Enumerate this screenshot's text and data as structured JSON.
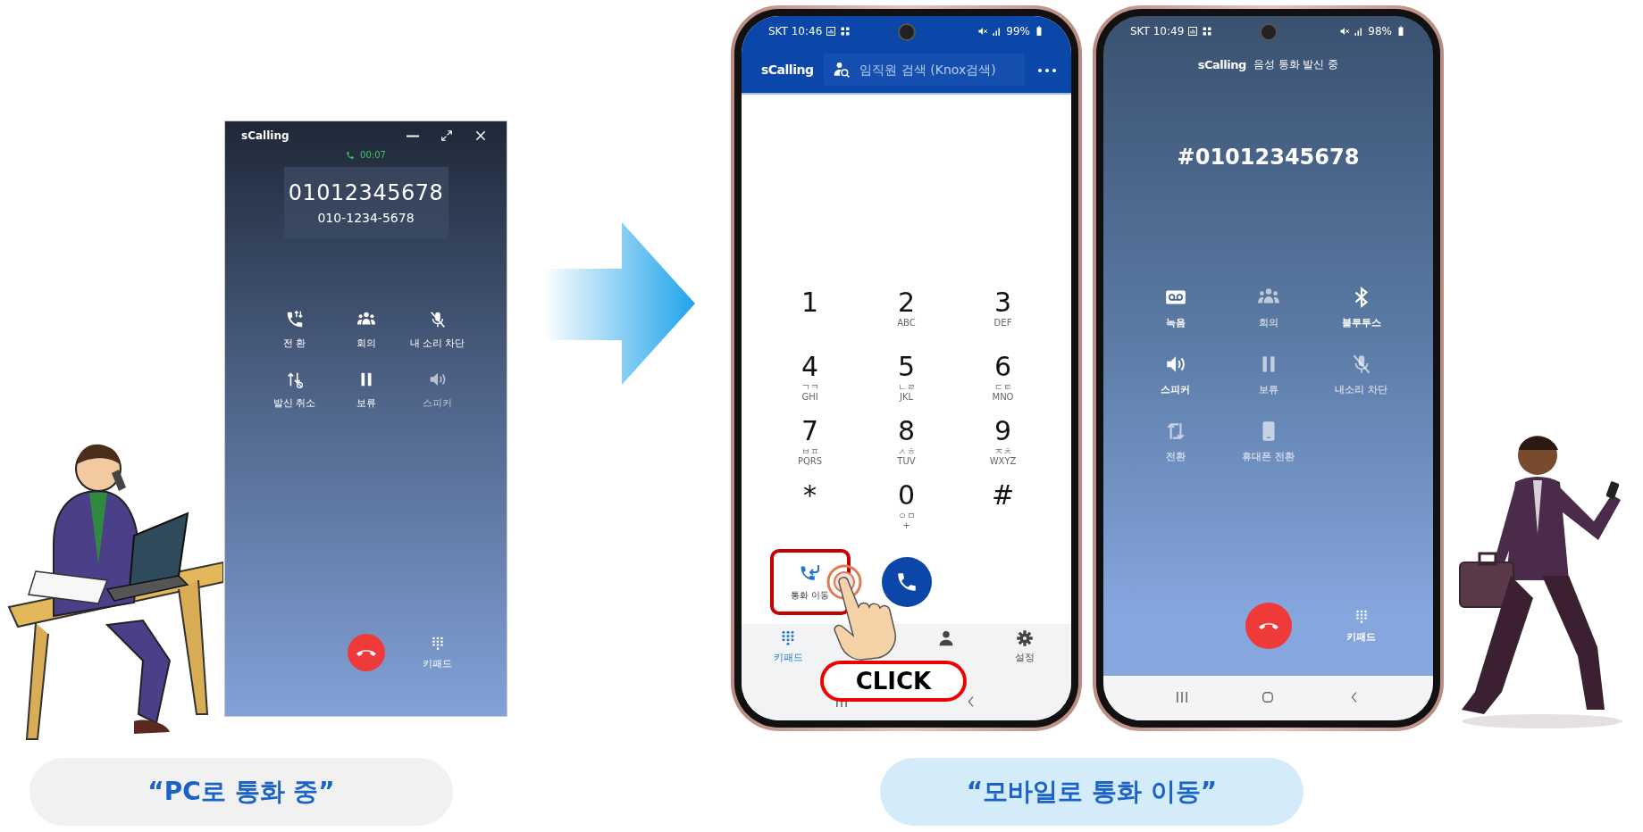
{
  "pc_window": {
    "title": "sCalling",
    "timer": "00:07",
    "number": "01012345678",
    "formatted_number": "010-1234-5678",
    "buttons": [
      {
        "kind": "phone_switch",
        "label": "전 환",
        "disabled": false
      },
      {
        "kind": "group",
        "label": "회의",
        "disabled": false
      },
      {
        "kind": "mic_off",
        "label": "내 소리 차단",
        "disabled": false
      },
      {
        "kind": "transfer_cancel",
        "label": "발신 취소",
        "disabled": false
      },
      {
        "kind": "pause",
        "label": "보류",
        "disabled": false
      },
      {
        "kind": "speaker",
        "label": "스피커",
        "disabled": true
      }
    ],
    "keypad_label": "키패드"
  },
  "dialer_phone": {
    "status_bar": {
      "carrier_time": "SKT 10:46",
      "battery": "99%"
    },
    "app_name": "sCalling",
    "search": {
      "placeholder": "임직원 검색 (Knox검색)"
    },
    "keys": [
      {
        "digit": "1"
      },
      {
        "digit": "2",
        "letters": [
          "ABC"
        ]
      },
      {
        "digit": "3",
        "letters": [
          "DEF"
        ]
      },
      {
        "digit": "4",
        "letters": [
          "ㄱㅋ",
          "GHI"
        ]
      },
      {
        "digit": "5",
        "letters": [
          "ㄴㄹ",
          "JKL"
        ]
      },
      {
        "digit": "6",
        "letters": [
          "ㄷㅌ",
          "MNO"
        ]
      },
      {
        "digit": "7",
        "letters": [
          "ㅂㅍ",
          "PQRS"
        ]
      },
      {
        "digit": "8",
        "letters": [
          "ㅅㅎ",
          "TUV"
        ]
      },
      {
        "digit": "9",
        "letters": [
          "ㅈㅊ",
          "WXYZ"
        ]
      },
      {
        "digit": "*"
      },
      {
        "digit": "0",
        "letters": [
          "ㅇㅁ",
          "+"
        ]
      },
      {
        "digit": "#"
      }
    ],
    "call_move_button": {
      "label": "통화 이동",
      "highlighted": true
    },
    "tabs": [
      {
        "kind": "keypad",
        "label": "키패드",
        "selected": true
      },
      {
        "kind": "person",
        "selected": false
      },
      {
        "kind": "gear",
        "label": "설정",
        "selected": false
      }
    ],
    "click_badge": "CLICK"
  },
  "call_phone": {
    "status_bar": {
      "carrier_time": "SKT 10:49",
      "battery": "98%"
    },
    "app_name": "sCalling",
    "call_status": "음성 통화 발신 중",
    "number": "#01012345678",
    "buttons": [
      {
        "kind": "voicemail",
        "label": "녹음",
        "disabled": false
      },
      {
        "kind": "group",
        "label": "회의",
        "disabled": true
      },
      {
        "kind": "bluetooth",
        "label": "블루투스",
        "disabled": false
      },
      {
        "kind": "speaker",
        "label": "스피커",
        "disabled": false
      },
      {
        "kind": "pause",
        "label": "보류",
        "disabled": true
      },
      {
        "kind": "mic_off",
        "label": "내소리 차단",
        "disabled": true
      },
      {
        "kind": "transfer",
        "label": "전환",
        "disabled": true
      },
      {
        "kind": "device",
        "label": "휴대폰 전환",
        "disabled": true
      }
    ],
    "keypad_label": "키패드"
  },
  "captions": [
    "“PC로 통화 중”",
    "“모바일로 통화 이동”"
  ]
}
